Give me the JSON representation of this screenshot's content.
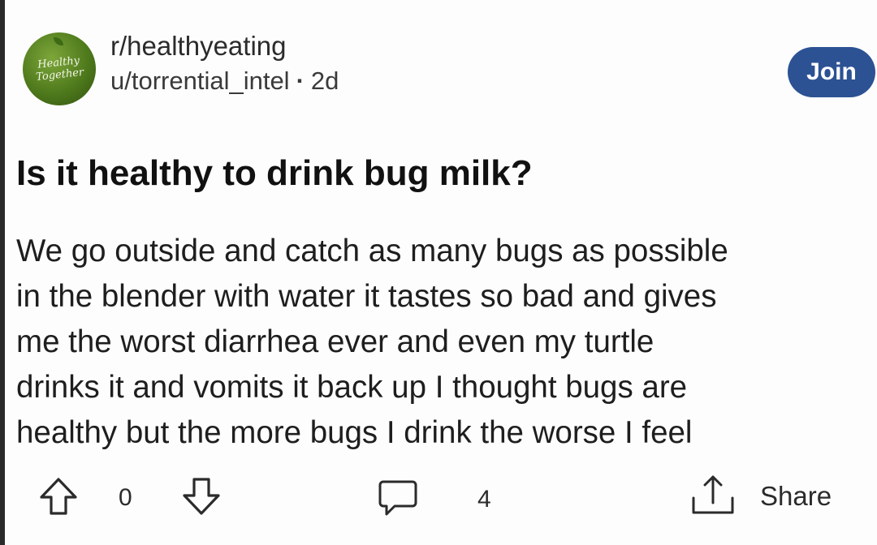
{
  "community": {
    "avatar_text": "Healthy Together",
    "name": "r/healthyeating",
    "author": "u/torrential_intel",
    "age": "2d",
    "join_label": "Join"
  },
  "post": {
    "title": "Is it healthy to drink bug milk?",
    "body_lines": [
      "We go outside and catch as many bugs as possible",
      "in the blender with water it tastes so bad and gives",
      "me the worst diarrhea ever and even my turtle",
      "drinks it and vomits it back up I thought bugs are",
      "healthy but the more bugs I drink the worse I feel"
    ]
  },
  "actions": {
    "upvote_icon": "arrow-up-outline-icon",
    "downvote_icon": "arrow-down-outline-icon",
    "vote_count": "0",
    "comment_icon": "speech-bubble-icon",
    "comment_count": "4",
    "share_icon": "share-upload-icon",
    "share_label": "Share"
  },
  "colors": {
    "join_button": "#2c5294",
    "text": "#1c1c1c",
    "avatar_green": "#4f7a1c"
  }
}
